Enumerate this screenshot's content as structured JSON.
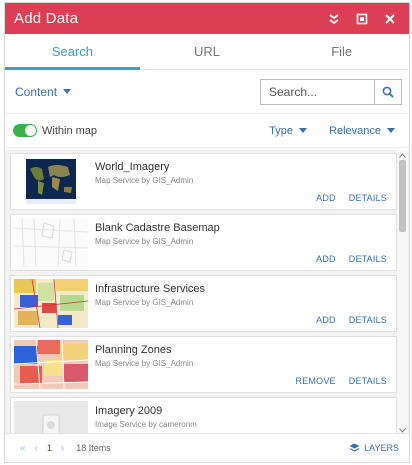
{
  "window": {
    "title": "Add Data"
  },
  "tabs": [
    {
      "label": "Search",
      "active": true
    },
    {
      "label": "URL",
      "active": false
    },
    {
      "label": "File",
      "active": false
    }
  ],
  "search": {
    "content_label": "Content",
    "placeholder": "Search..."
  },
  "filters": {
    "within_map_label": "Within map",
    "within_map_on": true,
    "type_label": "Type",
    "relevance_label": "Relevance"
  },
  "items": [
    {
      "title": "World_Imagery",
      "subtitle": "Map Service by GIS_Admin",
      "actions": [
        "ADD",
        "DETAILS"
      ]
    },
    {
      "title": "Blank Cadastre Basemap",
      "subtitle": "Map Service by GIS_Admin",
      "actions": [
        "ADD",
        "DETAILS"
      ]
    },
    {
      "title": "Infrastructure Services",
      "subtitle": "Map Service by GIS_Admin",
      "actions": [
        "ADD",
        "DETAILS"
      ]
    },
    {
      "title": "Planning Zones",
      "subtitle": "Map Service by GIS_Admin",
      "actions": [
        "REMOVE",
        "DETAILS"
      ]
    },
    {
      "title": "Imagery 2009",
      "subtitle": "Image Service by cameronm",
      "actions": []
    }
  ],
  "footer": {
    "page": "1",
    "count": "18 Items",
    "layers_label": "LAYERS"
  },
  "colors": {
    "titlebar": "#dc3f55",
    "accent": "#3aa0c9",
    "link": "#3a6fb0",
    "toggle": "#3bb14a"
  }
}
